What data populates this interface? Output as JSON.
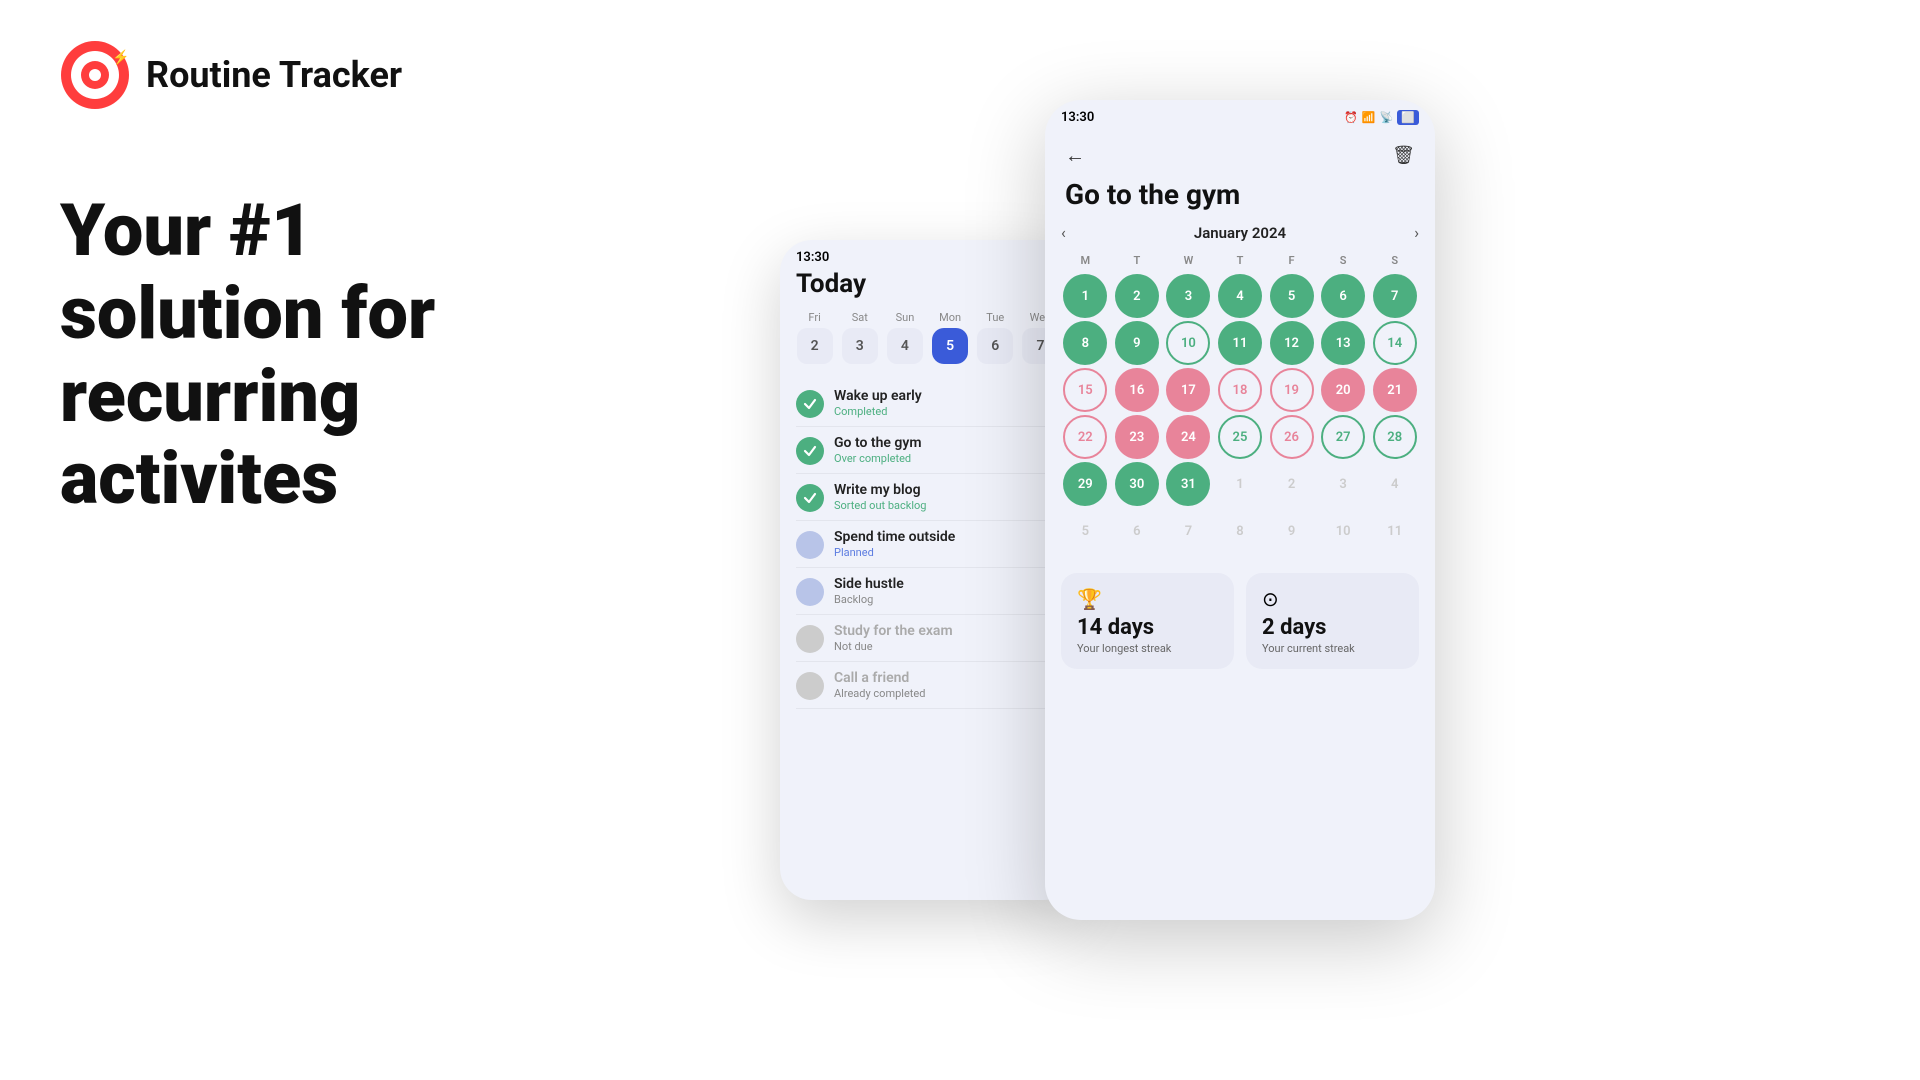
{
  "app": {
    "logo_text": "Routine Tracker",
    "hero_line1": "Your #1",
    "hero_line2": "solution for",
    "hero_line3": "recurring",
    "hero_line4": "activites"
  },
  "phone1": {
    "status_time": "13:30",
    "screen_title": "Today",
    "days": [
      {
        "label": "Fri",
        "num": "2",
        "active": false
      },
      {
        "label": "Sat",
        "num": "3",
        "active": false
      },
      {
        "label": "Sun",
        "num": "4",
        "active": false
      },
      {
        "label": "Mon",
        "num": "5",
        "active": true
      },
      {
        "label": "Tue",
        "num": "6",
        "active": false
      },
      {
        "label": "Wed",
        "num": "7",
        "active": false
      }
    ],
    "tasks": [
      {
        "name": "Wake up early",
        "status": "Completed",
        "status_class": "status-completed",
        "check_class": "completed",
        "faded": false
      },
      {
        "name": "Go to the gym",
        "status": "Over completed",
        "status_class": "status-overcompleted",
        "check_class": "completed",
        "faded": false
      },
      {
        "name": "Write my blog",
        "status": "Sorted out backlog",
        "status_class": "status-sorted",
        "check_class": "completed",
        "faded": false
      },
      {
        "name": "Spend time outside",
        "status": "Planned",
        "status_class": "status-planned",
        "check_class": "planned",
        "faded": false
      },
      {
        "name": "Side hustle",
        "status": "Backlog",
        "status_class": "status-backlog",
        "check_class": "planned",
        "faded": false
      },
      {
        "name": "Study for the exam",
        "status": "Not due",
        "status_class": "status-notdue",
        "check_class": "notdue",
        "faded": true
      },
      {
        "name": "Call a friend",
        "status": "Already completed",
        "status_class": "status-already",
        "check_class": "alreadydone",
        "faded": true
      }
    ]
  },
  "phone2": {
    "status_time": "13:30",
    "gym_title": "Go to the gym",
    "calendar": {
      "month": "January 2024",
      "dow": [
        "M",
        "T",
        "W",
        "T",
        "F",
        "S",
        "S"
      ],
      "weeks": [
        [
          {
            "n": "1",
            "t": "green"
          },
          {
            "n": "2",
            "t": "green"
          },
          {
            "n": "3",
            "t": "green"
          },
          {
            "n": "4",
            "t": "green"
          },
          {
            "n": "5",
            "t": "green"
          },
          {
            "n": "6",
            "t": "green"
          },
          {
            "n": "7",
            "t": "green"
          }
        ],
        [
          {
            "n": "8",
            "t": "green"
          },
          {
            "n": "9",
            "t": "green"
          },
          {
            "n": "10",
            "t": "outline-green"
          },
          {
            "n": "11",
            "t": "green"
          },
          {
            "n": "12",
            "t": "green"
          },
          {
            "n": "13",
            "t": "green"
          },
          {
            "n": "14",
            "t": "outline-green"
          }
        ],
        [
          {
            "n": "15",
            "t": "outline-pink"
          },
          {
            "n": "16",
            "t": "pink"
          },
          {
            "n": "17",
            "t": "pink"
          },
          {
            "n": "18",
            "t": "outline-pink"
          },
          {
            "n": "19",
            "t": "outline-pink"
          },
          {
            "n": "20",
            "t": "pink"
          },
          {
            "n": "21",
            "t": "pink"
          }
        ],
        [
          {
            "n": "22",
            "t": "outline-pink"
          },
          {
            "n": "23",
            "t": "pink"
          },
          {
            "n": "24",
            "t": "pink"
          },
          {
            "n": "25",
            "t": "outline-green"
          },
          {
            "n": "26",
            "t": "outline-pink"
          },
          {
            "n": "27",
            "t": "outline-green"
          },
          {
            "n": "28",
            "t": "outline-green"
          }
        ],
        [
          {
            "n": "29",
            "t": "green"
          },
          {
            "n": "30",
            "t": "green"
          },
          {
            "n": "31",
            "t": "green"
          },
          {
            "n": "1",
            "t": "empty"
          },
          {
            "n": "2",
            "t": "empty"
          },
          {
            "n": "3",
            "t": "empty"
          },
          {
            "n": "4",
            "t": "empty"
          }
        ],
        [
          {
            "n": "5",
            "t": "empty"
          },
          {
            "n": "6",
            "t": "empty"
          },
          {
            "n": "7",
            "t": "empty"
          },
          {
            "n": "8",
            "t": "empty"
          },
          {
            "n": "9",
            "t": "empty"
          },
          {
            "n": "10",
            "t": "empty"
          },
          {
            "n": "11",
            "t": "empty"
          }
        ]
      ]
    },
    "streaks": {
      "longest_days": "14 days",
      "longest_label": "Your longest streak",
      "current_days": "2 days",
      "current_label": "Your current streak"
    }
  }
}
